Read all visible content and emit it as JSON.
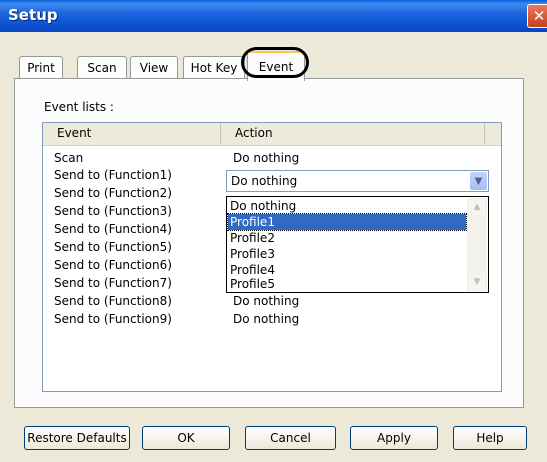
{
  "window": {
    "title": "Setup",
    "close_glyph": "✕"
  },
  "tabs": [
    {
      "label": "Print"
    },
    {
      "label": "Scan"
    },
    {
      "label": "View"
    },
    {
      "label": "Hot Key"
    },
    {
      "label": "Event",
      "active": true
    }
  ],
  "event_lists": {
    "label": "Event lists :",
    "columns": [
      "Event",
      "Action"
    ],
    "rows": [
      {
        "event": "Scan",
        "action": "Do nothing"
      },
      {
        "event": "Send to (Function1)",
        "action": "Do nothing"
      },
      {
        "event": "Send to (Function2)",
        "action": ""
      },
      {
        "event": "Send to (Function3)",
        "action": ""
      },
      {
        "event": "Send to (Function4)",
        "action": ""
      },
      {
        "event": "Send to (Function5)",
        "action": ""
      },
      {
        "event": "Send to (Function6)",
        "action": ""
      },
      {
        "event": "Send to (Function7)",
        "action": ""
      },
      {
        "event": "Send to (Function8)",
        "action": "Do nothing"
      },
      {
        "event": "Send to (Function9)",
        "action": "Do nothing"
      }
    ]
  },
  "action_combo": {
    "value": "Do nothing",
    "options": [
      "Do nothing",
      "Profile1",
      "Profile2",
      "Profile3",
      "Profile4",
      "Profile5"
    ],
    "highlighted": "Profile1"
  },
  "buttons": {
    "restore_defaults": "Restore Defaults",
    "ok": "OK",
    "cancel": "Cancel",
    "apply": "Apply",
    "help": "Help"
  },
  "colors": {
    "title_bar": "#0a5fd8",
    "selection": "#316ac5",
    "dialog_bg": "#ece9d8"
  }
}
